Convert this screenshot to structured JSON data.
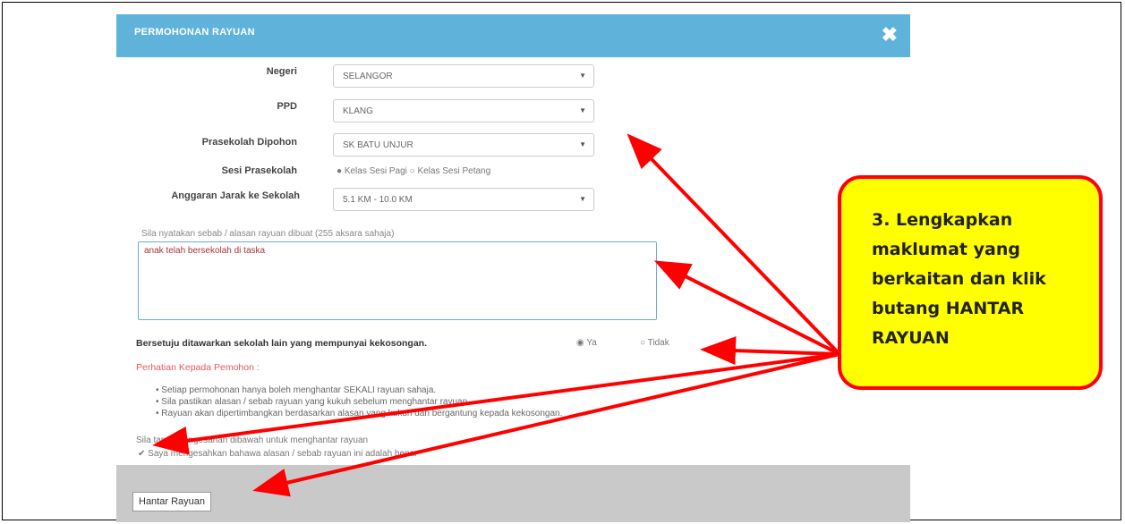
{
  "modal": {
    "title": "PERMOHONAN RAYUAN",
    "close_icon": "close-icon",
    "fields": {
      "negeri": {
        "label": "Negeri",
        "value": "SELANGOR"
      },
      "ppd": {
        "label": "PPD",
        "value": "KLANG"
      },
      "prasekolah": {
        "label": "Prasekolah Dipohon",
        "value": "SK BATU UNJUR"
      },
      "sesi": {
        "label": "Sesi Prasekolah",
        "value": "● Kelas Sesi Pagi  ○ Kelas Sesi Petang"
      },
      "jarak": {
        "label": "Anggaran Jarak ke Sekolah",
        "value": "5.1 KM - 10.0 KM"
      }
    },
    "reason": {
      "hint": "Sila nyatakan sebab / alasan rayuan dibuat (255 aksara sahaja)",
      "value": "anak telah bersekolah di taska"
    },
    "agree": {
      "question": "Bersetuju ditawarkan sekolah lain yang mempunyai kekosongan.",
      "yes": "Ya",
      "no": "Tidak"
    },
    "notice": {
      "heading": "Perhatian Kepada Pemohon :",
      "items": [
        "•  Setiap permohonan hanya boleh menghantar SEKALI rayuan sahaja.",
        "•  Sila pastikan alasan / sebab rayuan yang kukuh sebelum menghantar rayuan.",
        "•  Rayuan akan dipertimbangkan berdasarkan alasan yang kukuh dan bergantung kepada kekosongan."
      ]
    },
    "confirm": {
      "label": "Sila tanda pengesahan dibawah untuk menghantar rayuan",
      "check": "Saya mengesahkan bahawa alasan / sebab rayuan ini adalah benar"
    },
    "submit_label": "Hantar Rayuan"
  },
  "callout": {
    "text": "3. Lengkapkan\nmaklumat yang\nberkaitan dan klik\nbutang HANTAR\nRAYUAN"
  },
  "colors": {
    "header": "#5fb3da",
    "callout_fill": "#ffff00",
    "callout_border": "#ff0000",
    "arrow": "#ff0000"
  }
}
